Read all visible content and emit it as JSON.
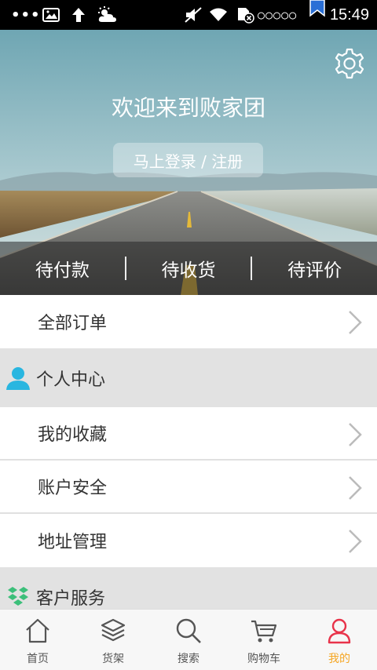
{
  "status_bar": {
    "dots": "•••",
    "clock": "15:49",
    "signal": "○○○○○"
  },
  "hero": {
    "welcome": "欢迎来到败家团",
    "login_label": "马上登录 / 注册",
    "order_status": [
      {
        "label": "待付款"
      },
      {
        "label": "待收货"
      },
      {
        "label": "待评价"
      }
    ]
  },
  "list": {
    "all_orders": "全部订单",
    "personal_center": "个人中心",
    "favorites": "我的收藏",
    "account_security": "账户安全",
    "address_management": "地址管理",
    "customer_service": "客户服务"
  },
  "bottom_nav": [
    {
      "label": "首页",
      "icon": "home-icon"
    },
    {
      "label": "货架",
      "icon": "layers-icon"
    },
    {
      "label": "搜索",
      "icon": "search-icon"
    },
    {
      "label": "购物车",
      "icon": "cart-icon"
    },
    {
      "label": "我的",
      "icon": "user-icon",
      "active": true
    }
  ],
  "colors": {
    "active_tab": "#f5a623",
    "inactive_icon": "#555555",
    "profile_active": "#e8334a",
    "person_icon": "#29b6e0",
    "service_icon": "#3cbf7a",
    "section_bg": "#e2e2e2"
  }
}
